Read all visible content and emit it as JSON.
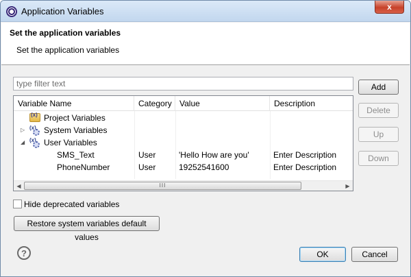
{
  "window": {
    "title": "Application Variables",
    "close_label": "x"
  },
  "header": {
    "title": "Set the application variables",
    "subtitle": "Set the application variables"
  },
  "filter": {
    "placeholder": "type filter text",
    "value": ""
  },
  "table": {
    "columns": [
      "Variable Name",
      "Category",
      "Value",
      "Description"
    ],
    "groups": [
      {
        "label": "Project Variables",
        "icon": "project-variables-icon",
        "expanded": null
      },
      {
        "label": "System Variables",
        "icon": "system-variables-icon",
        "expanded": false,
        "arrow": "▷"
      },
      {
        "label": "User Variables",
        "icon": "user-variables-icon",
        "expanded": true,
        "arrow": "◢"
      }
    ],
    "rows": [
      {
        "name": "SMS_Text",
        "category": "User",
        "value": "'Hello How are you'",
        "description": "Enter Description"
      },
      {
        "name": "PhoneNumber",
        "category": "User",
        "value": "19252541600",
        "description": "Enter Description"
      }
    ],
    "scroll": {
      "left": "◀",
      "right": "▶",
      "grip": "III"
    }
  },
  "side_buttons": {
    "add": "Add",
    "delete": "Delete",
    "up": "Up",
    "down": "Down"
  },
  "options": {
    "hide_deprecated_label": "Hide deprecated variables",
    "hide_deprecated_checked": false,
    "restore_label": "Restore system variables default values"
  },
  "footer": {
    "help_glyph": "?",
    "ok": "OK",
    "cancel": "Cancel"
  },
  "colors": {
    "accent": "#3c7fb1",
    "titlebar": "#c2d7ee",
    "close": "#c7422a"
  }
}
